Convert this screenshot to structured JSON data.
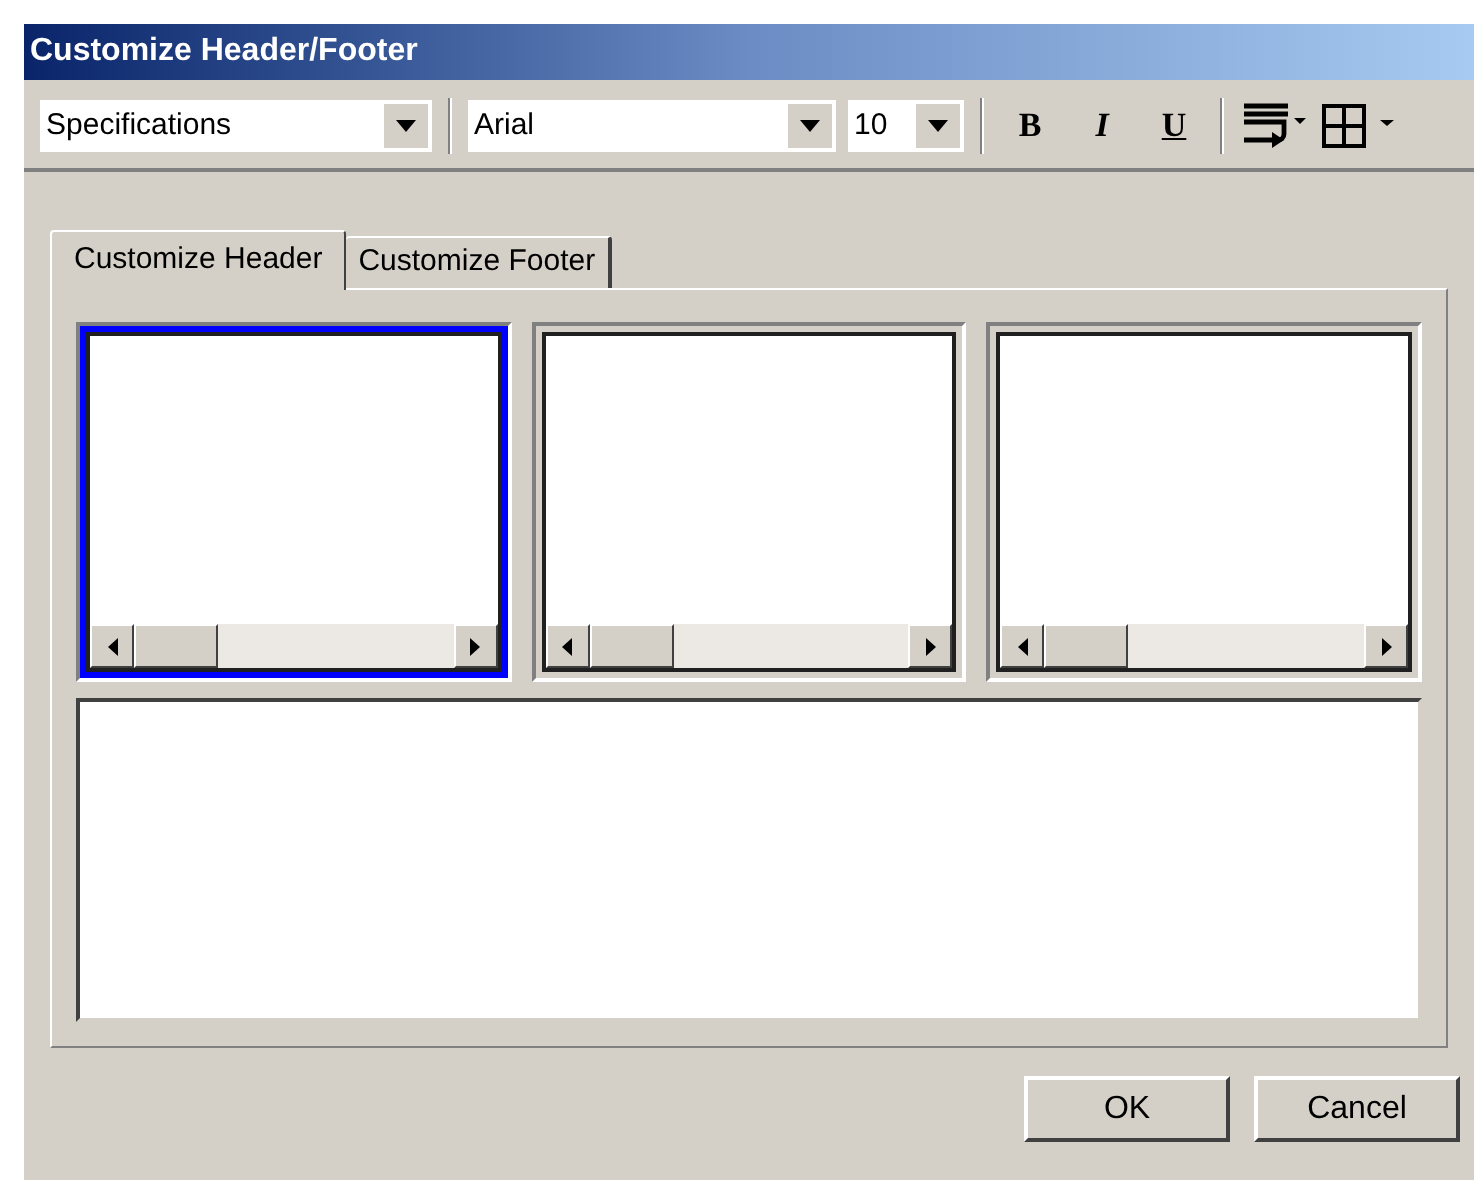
{
  "window": {
    "title": "Customize Header/Footer"
  },
  "toolbar": {
    "style_select": {
      "value": "Specifications"
    },
    "font_select": {
      "value": "Arial"
    },
    "size_select": {
      "value": "10"
    },
    "format_buttons": [
      {
        "label": "B",
        "kind": "bold"
      },
      {
        "label": "I",
        "kind": "italic"
      },
      {
        "label": "U",
        "kind": "underline"
      }
    ]
  },
  "tabs": [
    {
      "label": "Customize Header",
      "selected": true
    },
    {
      "label": "Customize Footer",
      "selected": false
    }
  ],
  "sections": [
    {
      "selected": true
    },
    {
      "selected": false
    },
    {
      "selected": false
    }
  ],
  "buttons": [
    "OK",
    "Cancel"
  ]
}
